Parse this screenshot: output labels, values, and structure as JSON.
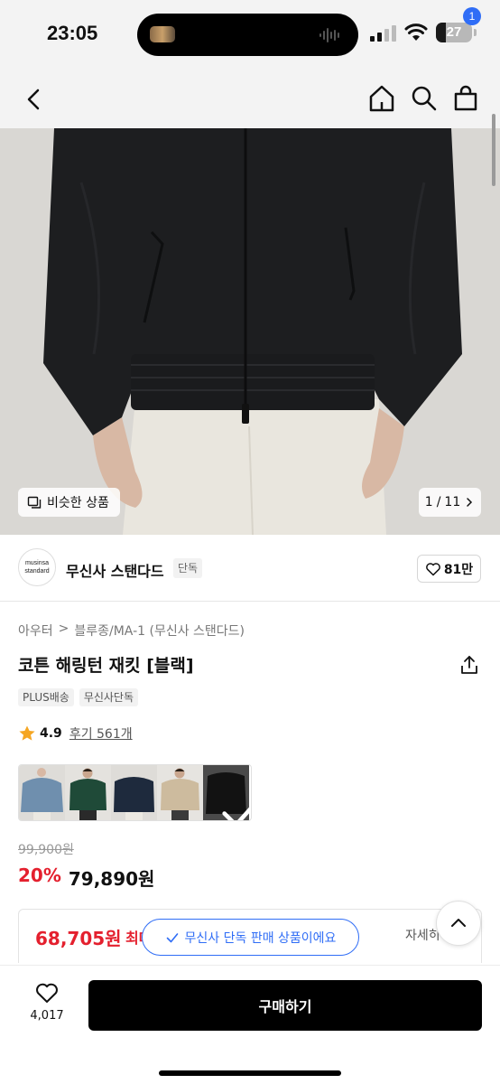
{
  "status_bar": {
    "time": "23:05",
    "battery": "27",
    "battery_level": 0.27
  },
  "nav": {
    "cart_count": "1",
    "icons": [
      "chevron-left-icon",
      "home-icon",
      "search-icon",
      "cart-icon"
    ]
  },
  "gallery": {
    "similar_label": "비슷한 상품",
    "page_current": "1",
    "page_separator": "/",
    "page_total": "11",
    "next_icon": "chevron-right-icon"
  },
  "brand": {
    "logo_line1": "musinsa",
    "logo_line2": "standard",
    "name": "무신사 스탠다드",
    "tag": "단독",
    "likes": "81만"
  },
  "product": {
    "breadcrumb_category": "아우터",
    "breadcrumb_separator": ">",
    "breadcrumb_sub": "블루종/MA-1 (무신사 스탠다드)",
    "title": "코튼 해링턴 재킷 [블랙]",
    "tags": [
      "PLUS배송",
      "무신사단독"
    ],
    "rating": "4.9",
    "reviews": "후기 561개",
    "colors": [
      {
        "name": "blue",
        "hex": "#6f8fae"
      },
      {
        "name": "green",
        "hex": "#1f4a38"
      },
      {
        "name": "navy",
        "hex": "#1e2a3d"
      },
      {
        "name": "beige",
        "hex": "#cdbb9e"
      },
      {
        "name": "black",
        "hex": "#121212",
        "selected": true
      }
    ]
  },
  "price": {
    "original": "99,900원",
    "discount": "20%",
    "sale": "79,890원"
  },
  "coupon": {
    "price": "68,705원",
    "label": "최대",
    "detail": "자세히",
    "toast": "무신사 단독 판매 상품이에요"
  },
  "bottom": {
    "like_count": "4,017",
    "buy_label": "구매하기"
  },
  "colors": {
    "accent": "#2f6df6",
    "sale": "#e4202e",
    "star": "#f5a623"
  }
}
